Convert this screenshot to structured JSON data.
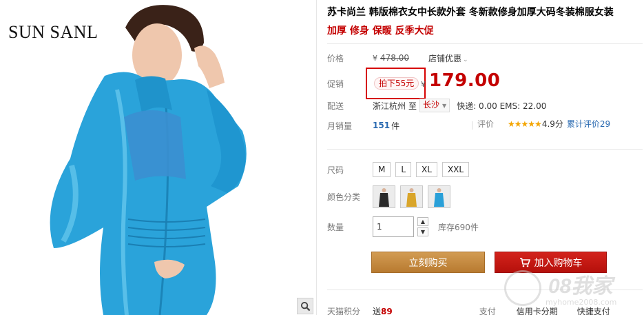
{
  "image_panel": {
    "brand": "SUN SANL",
    "zoom_icon": "magnifier-icon"
  },
  "product": {
    "title": "苏卡尚兰 韩版棉衣女中长款外套 冬新款修身加厚大码冬装棉服女装",
    "subtitle": "加厚 修身 保暖 反季大促"
  },
  "price": {
    "label": "价格",
    "currency": "¥",
    "original": "478.00",
    "shop_discount": "店铺优惠"
  },
  "promo": {
    "label": "促销",
    "tag": "拍下55元",
    "currency": "¥",
    "price": "179.00"
  },
  "shipping": {
    "label": "配送",
    "from": "浙江杭州",
    "to_word": "至",
    "destination": "长沙",
    "fees": "快递: 0.00 EMS: 22.00"
  },
  "sales": {
    "label": "月销量",
    "count": "151",
    "unit": "件",
    "rating_label": "评价",
    "stars": "★★★★★",
    "score": "4.9分",
    "reviews": "累计评价29"
  },
  "size": {
    "label": "尺码",
    "options": [
      "M",
      "L",
      "XL",
      "XXL"
    ]
  },
  "color": {
    "label": "颜色分类",
    "options": [
      {
        "name": "black-coat",
        "hex": "#2b2b2b"
      },
      {
        "name": "yellow-coat",
        "hex": "#d9a52a"
      },
      {
        "name": "blue-coat",
        "hex": "#2aa0d8"
      }
    ]
  },
  "quantity": {
    "label": "数量",
    "value": "1",
    "up": "▲",
    "down": "▼",
    "stock": "库存690件"
  },
  "actions": {
    "buy_now": "立刻购买",
    "add_cart": "加入购物车"
  },
  "bottom": {
    "points_label": "天猫积分",
    "points": "送",
    "points_value": "89",
    "pay_label": "支付",
    "pay_value": "信用卡分期",
    "fast_label": "快捷支付"
  },
  "watermark": {
    "text": "08我家",
    "url": "myhome2008.com"
  },
  "colors": {
    "accent_red": "#c40000",
    "link_blue": "#2a6ab1",
    "buy_gold": "#c5893c",
    "cart_red": "#c8180f"
  }
}
